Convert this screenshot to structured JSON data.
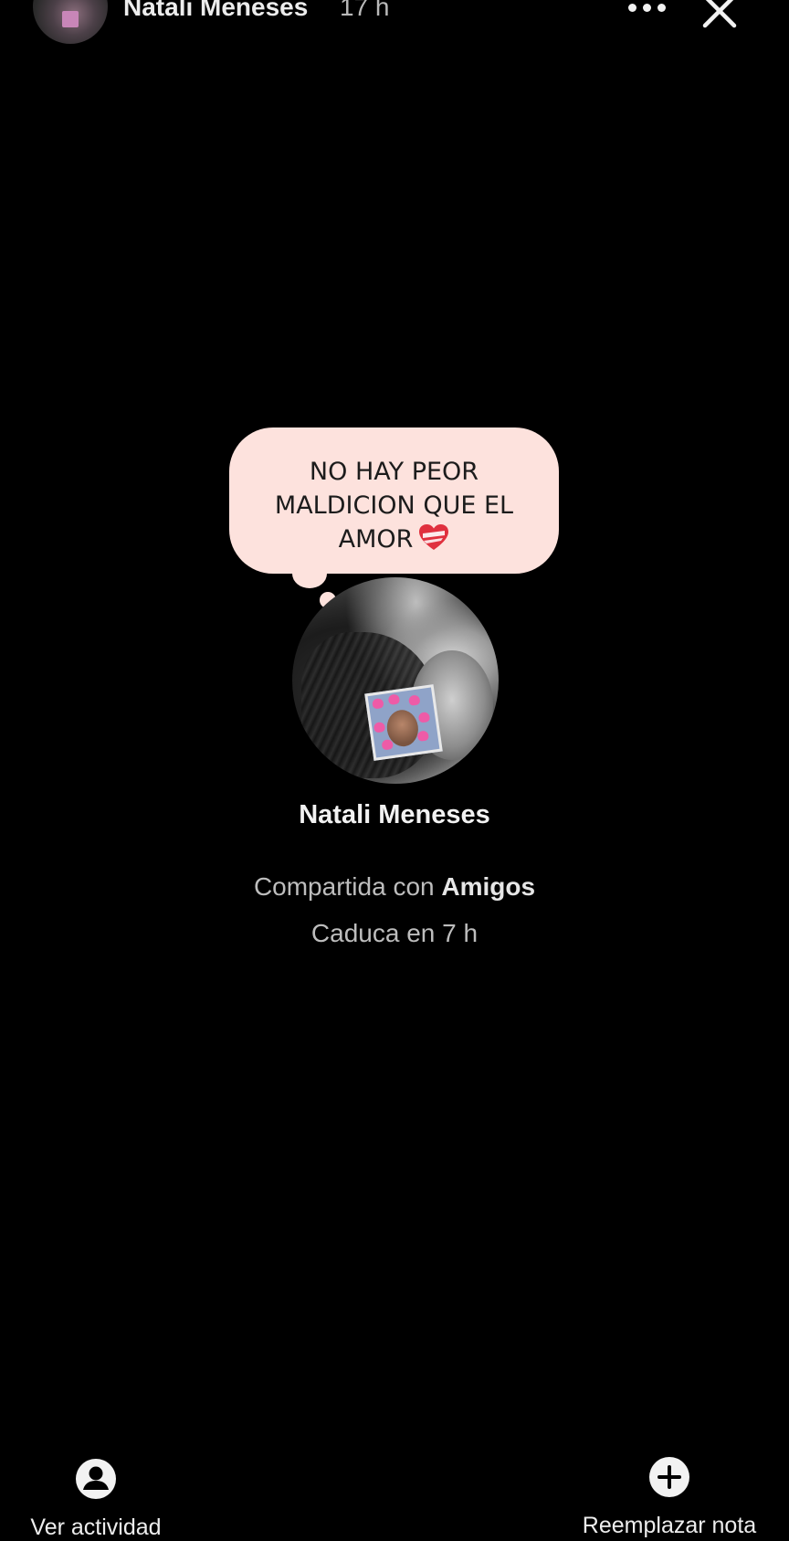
{
  "header": {
    "user_name": "Natali Meneses",
    "time_ago": "17 h"
  },
  "note": {
    "text": "NO HAY PEOR\nMALDICION  QUE EL\nAMOR",
    "emoji": "heart-icon"
  },
  "profile": {
    "name": "Natali Meneses",
    "shared_prefix": "Compartida con",
    "shared_audience": "Amigos",
    "expires": "Caduca en 7 h"
  },
  "actions": {
    "view_activity": "Ver actividad",
    "replace_note": "Reemplazar nota"
  },
  "colors": {
    "background": "#000000",
    "bubble": "#fde2dd",
    "heart": "#e0303e"
  }
}
